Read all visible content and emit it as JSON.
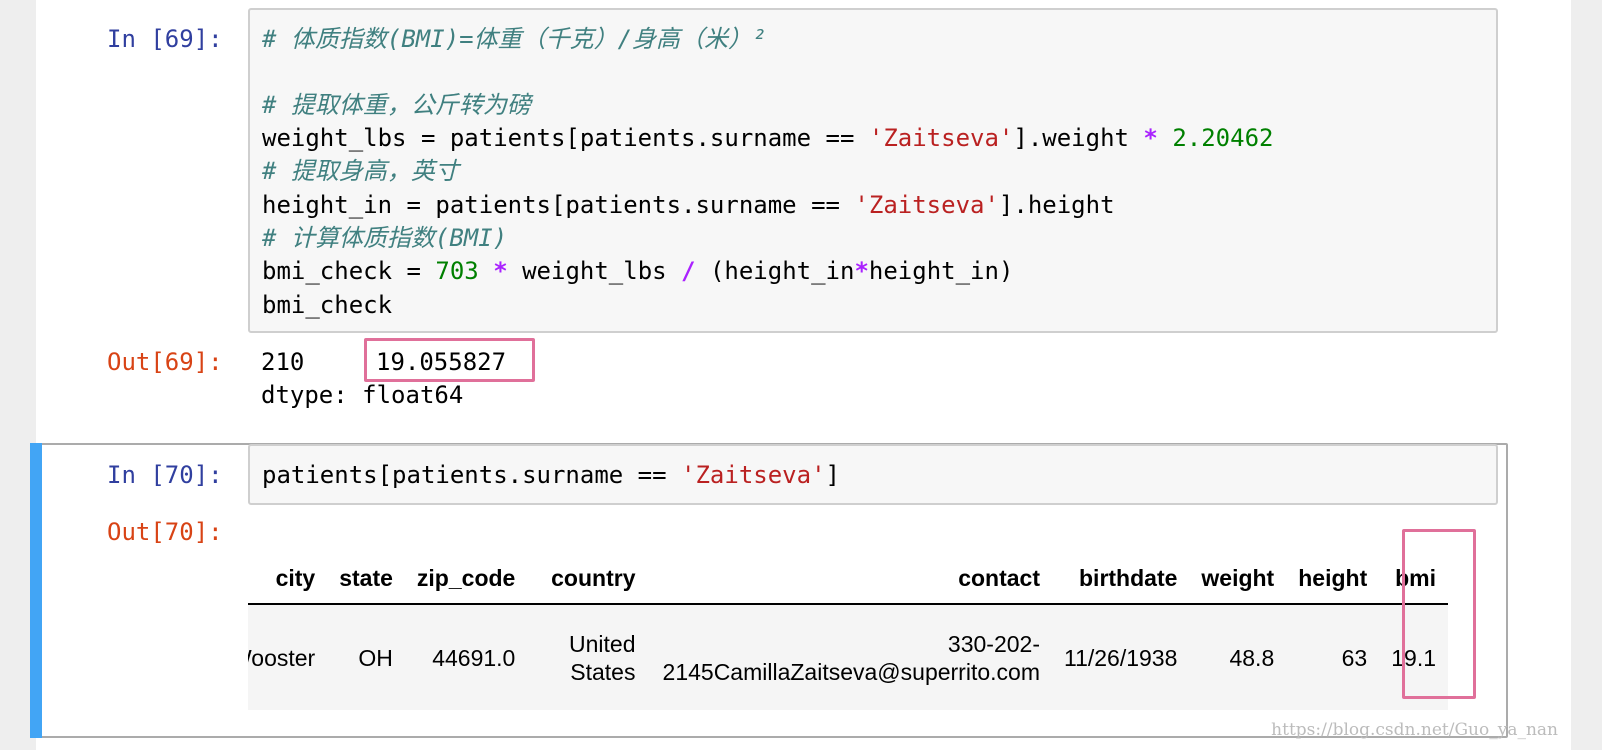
{
  "cells": [
    {
      "in_prompt": "In [69]:",
      "code": {
        "line1": "# 体质指数(BMI)=体重（千克）/身高（米）²",
        "line3": "# 提取体重，公斤转为磅",
        "line4_a": "weight_lbs = patients[patients.surname == ",
        "line4_str": "'Zaitseva'",
        "line4_b": "].weight ",
        "line4_op": "*",
        "line4_num": " 2.20462",
        "line5": "# 提取身高，英寸",
        "line6_a": "height_in = patients[patients.surname == ",
        "line6_str": "'Zaitseva'",
        "line6_b": "].height",
        "line7": "# 计算体质指数(BMI)",
        "line8_a": "bmi_check = ",
        "line8_num": "703",
        "line8_sp1": " ",
        "line8_op1": "*",
        "line8_b": " weight_lbs ",
        "line8_op2": "/",
        "line8_c": " (height_in",
        "line8_op3": "*",
        "line8_d": "height_in)",
        "line9": "bmi_check"
      },
      "out_prompt": "Out[69]:",
      "output": {
        "index": "210",
        "value": "19.055827",
        "dtype": "dtype: float64"
      }
    },
    {
      "in_prompt": "In [70]:",
      "code": {
        "line1_a": "patients[patients.surname == ",
        "line1_str": "'Zaitseva'",
        "line1_b": "]"
      },
      "out_prompt": "Out[70]:",
      "table": {
        "columns": [
          "city",
          "state",
          "zip_code",
          "country",
          "contact",
          "birthdate",
          "weight",
          "height",
          "bmi"
        ],
        "row": {
          "city": "Wooster",
          "state": "OH",
          "zip_code": "44691.0",
          "country_1": "United",
          "country_2": "States",
          "contact_1": "330-202-",
          "contact_2": "2145CamillaZaitseva@superrito.com",
          "birthdate": "11/26/1938",
          "weight": "48.8",
          "height": "63",
          "bmi": "19.1"
        }
      }
    }
  ],
  "watermark": "https://blog.csdn.net/Guo_ya_nan",
  "colors": {
    "selected_bar": "#42a5f5",
    "highlight": "#e0709a",
    "in_prompt": "#303f9f",
    "out_prompt": "#d84315"
  }
}
